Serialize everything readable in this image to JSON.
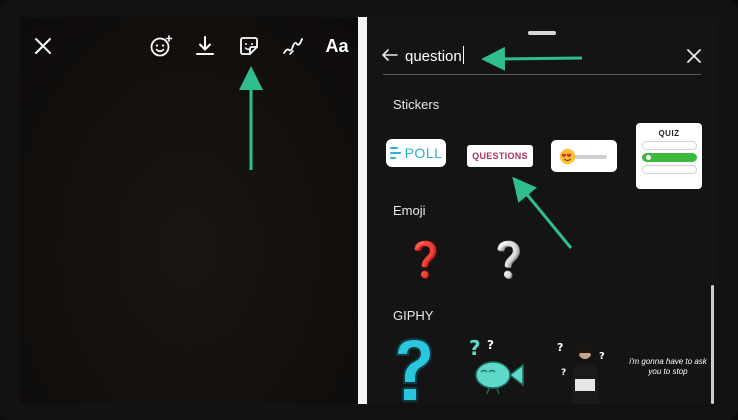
{
  "editor": {
    "close_icon": "close-icon",
    "emoji_icon": "emoji-sticker-icon",
    "download_icon": "download-icon",
    "sticker_icon": "sticker-icon",
    "draw_icon": "draw-icon",
    "text_label": "Aa"
  },
  "search": {
    "value": "question",
    "back_icon": "back-arrow-icon",
    "clear_icon": "close-icon"
  },
  "sections": {
    "stickers": "Stickers",
    "emoji": "Emoji",
    "giphy": "GIPHY"
  },
  "stickers": {
    "poll_label": "POLL",
    "questions_label": "QUESTIONS",
    "slider_emoji": "heart-eyes-emoji",
    "quiz_label": "QUIZ"
  },
  "emoji": {
    "red_question": "❓",
    "white_question": "❔"
  },
  "giphy": {
    "caption": "i'm gonna have to ask you to stop"
  },
  "colors": {
    "annotation_arrow": "#2fbf8f",
    "poll_blue": "#2bb0d6",
    "questions_magenta": "#b0306d",
    "quiz_green": "#3db93d",
    "gif_cyan": "#29c6dd"
  }
}
